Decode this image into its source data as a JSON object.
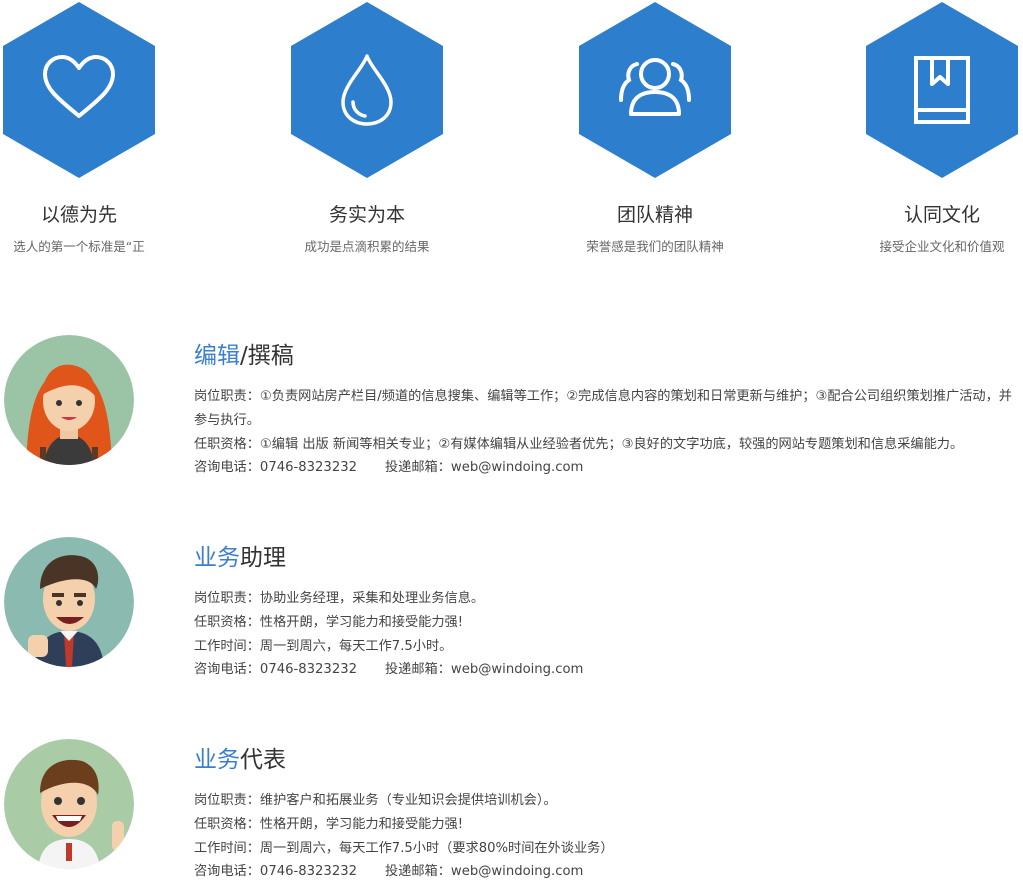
{
  "values": [
    {
      "icon": "heart-icon",
      "title": "以德为先",
      "desc": "选人的第一个标准是“正"
    },
    {
      "icon": "water-drop-icon",
      "title": "务实为本",
      "desc": "成功是点滴积累的结果"
    },
    {
      "icon": "team-icon",
      "title": "团队精神",
      "desc": "荣誉感是我们的团队精神"
    },
    {
      "icon": "book-icon",
      "title": "认同文化",
      "desc": "接受企业文化和价值观"
    }
  ],
  "accent_color": "#2d7ecc",
  "jobs": [
    {
      "title_highlight": "编辑",
      "title_rest": "/撰稿",
      "lines": [
        "岗位职责：①负责网站房产栏目/频道的信息搜集、编辑等工作；②完成信息内容的策划和日常更新与维护；③配合公司组织策划推广活动，并参与执行。",
        "任职资格：①编辑 出版 新闻等相关专业；②有媒体编辑从业经验者优先；③良好的文字功底，较强的网站专题策划和信息采编能力。"
      ],
      "phone": "咨询电话：0746-8323232",
      "email": "投递邮箱：web@windoing.com"
    },
    {
      "title_highlight": "业务",
      "title_rest": "助理",
      "lines": [
        "岗位职责：协助业务经理，采集和处理业务信息。",
        "任职资格：性格开朗，学习能力和接受能力强!",
        "工作时间：周一到周六，每天工作7.5小时。"
      ],
      "phone": "咨询电话：0746-8323232",
      "email": "投递邮箱：web@windoing.com"
    },
    {
      "title_highlight": "业务",
      "title_rest": "代表",
      "lines": [
        "岗位职责：维护客户和拓展业务（专业知识会提供培训机会）。",
        "任职资格：性格开朗，学习能力和接受能力强!",
        "工作时间：周一到周六，每天工作7.5小时（要求80%时间在外谈业务）"
      ],
      "phone": "咨询电话：0746-8323232",
      "email": "投递邮箱：web@windoing.com"
    }
  ]
}
